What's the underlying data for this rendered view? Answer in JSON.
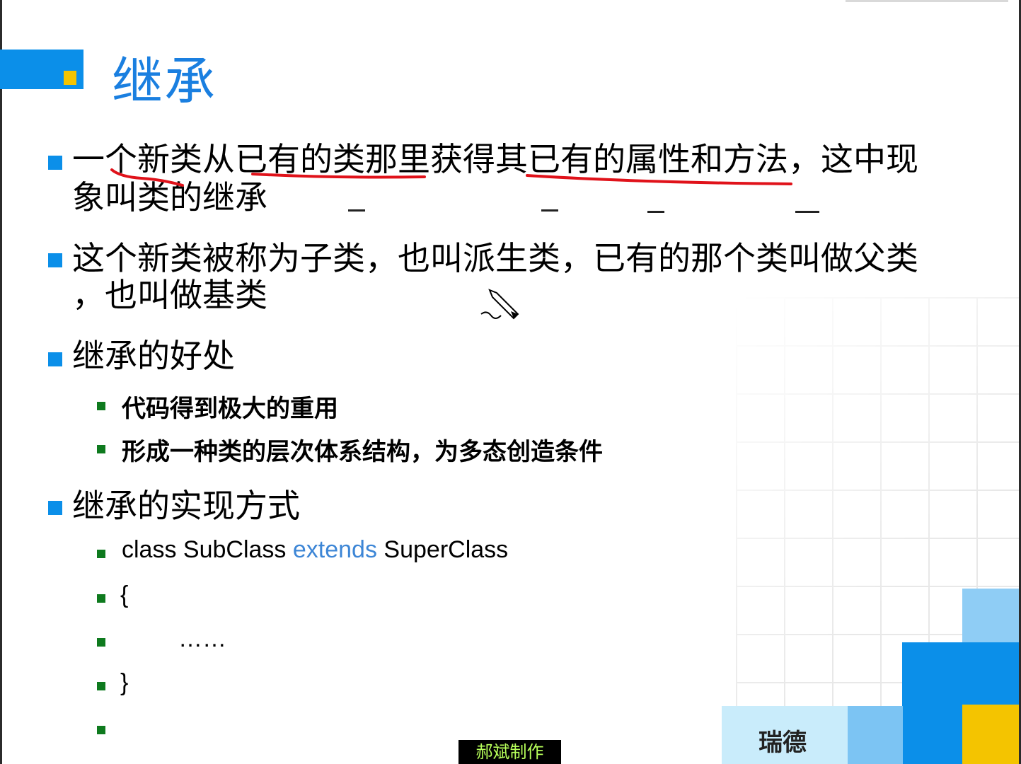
{
  "slide": {
    "title": "继承",
    "bullets": [
      {
        "line1": "一个新类从已有的类那里获得其已有的属性和方法，这中现",
        "line2": "象叫类的继承"
      },
      {
        "line1": "这个新类被称为子类，也叫派生类，已有的那个类叫做父类",
        "line2": "，也叫做基类"
      },
      {
        "line1": "继承的好处",
        "subs": [
          "代码得到极大的重用",
          "形成一种类的层次体系结构，为多态创造条件"
        ]
      },
      {
        "line1": "继承的实现方式"
      }
    ],
    "code": {
      "kw_class": "class SubClass",
      "kw_extends": "extends",
      "kw_super": "SuperClass",
      "open": "{",
      "body": "……",
      "close": "}"
    },
    "footer_brand": "瑞德",
    "watermark": "郝斌制作",
    "colors": {
      "accent_blue": "#0b8fe9",
      "title_blue": "#1a7fe0",
      "accent_yellow": "#f4c400",
      "sub_bullet_green": "#0e7a1e",
      "annotation_red": "#e0121a"
    }
  }
}
